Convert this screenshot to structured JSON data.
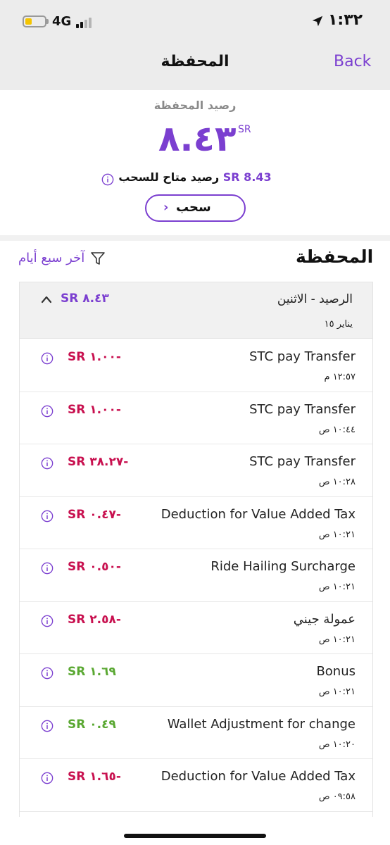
{
  "status_bar": {
    "time": "١:٣٢",
    "network": "4G"
  },
  "nav": {
    "back_label": "Back",
    "title": "المحفظة"
  },
  "balance": {
    "label": "رصيد المحفظة",
    "amount": "٨.٤٣",
    "currency": "SR",
    "available_label": "رصيد متاح للسحب",
    "available_amount": "SR 8.43",
    "withdraw_label": "سحب"
  },
  "section": {
    "title": "المحفظة",
    "filter_label": "آخر سبع أيام"
  },
  "group": {
    "label": "الرصيد - الاثنين",
    "date": "يناير ١٥",
    "total": "SR ٨.٤٣"
  },
  "transactions": [
    {
      "title": "STC pay Transfer",
      "time": "١٢:٥٧ م",
      "amount": "SR ١.٠٠-",
      "type": "debit"
    },
    {
      "title": "STC pay Transfer",
      "time": "١٠:٤٤ ص",
      "amount": "SR ١.٠٠-",
      "type": "debit"
    },
    {
      "title": "STC pay Transfer",
      "time": "١٠:٢٨ ص",
      "amount": "SR ٣٨.٢٧-",
      "type": "debit"
    },
    {
      "title": "Deduction for Value Added Tax",
      "time": "١٠:٢١ ص",
      "amount": "SR ٠.٤٧-",
      "type": "debit"
    },
    {
      "title": "Ride Hailing Surcharge",
      "time": "١٠:٢١ ص",
      "amount": "SR ٠.٥٠-",
      "type": "debit"
    },
    {
      "title": "عمولة جيني",
      "time": "١٠:٢١ ص",
      "amount": "SR ٢.٥٨-",
      "type": "debit"
    },
    {
      "title": "Bonus",
      "time": "١٠:٢١ ص",
      "amount": "SR ١.٦٩",
      "type": "credit"
    },
    {
      "title": "Wallet Adjustment for change",
      "time": "١٠:٢٠ ص",
      "amount": "SR ٠.٤٩",
      "type": "credit"
    },
    {
      "title": "Deduction for Value Added Tax",
      "time": "٠٩:٥٨ ص",
      "amount": "SR ١.٦٥-",
      "type": "debit"
    }
  ],
  "colors": {
    "accent": "#7b3fd0",
    "debit": "#c8104f",
    "credit": "#5aa832"
  }
}
